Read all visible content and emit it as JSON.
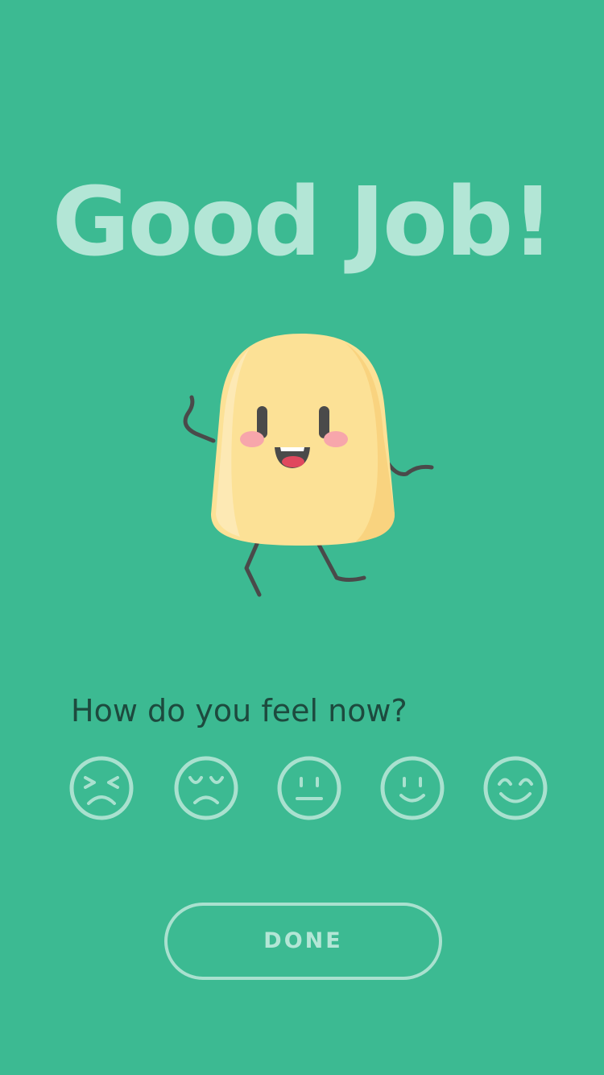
{
  "header": {
    "title": "Good Job!"
  },
  "mascot": {
    "icon": "happy-yellow-blob-character",
    "body_color": "#fce196",
    "limb_color": "#4a4a4a"
  },
  "mood_prompt": {
    "question": "How do you feel now?",
    "options": [
      {
        "icon": "very-upset-face-icon"
      },
      {
        "icon": "sad-face-icon"
      },
      {
        "icon": "neutral-face-icon"
      },
      {
        "icon": "smiling-face-icon"
      },
      {
        "icon": "very-happy-face-icon"
      }
    ]
  },
  "actions": {
    "done_label": "DONE"
  },
  "colors": {
    "background": "#3cba92",
    "title": "#b3e6d6",
    "question_text": "#1d4a3e",
    "icon_stroke": "#a9e1cf"
  }
}
